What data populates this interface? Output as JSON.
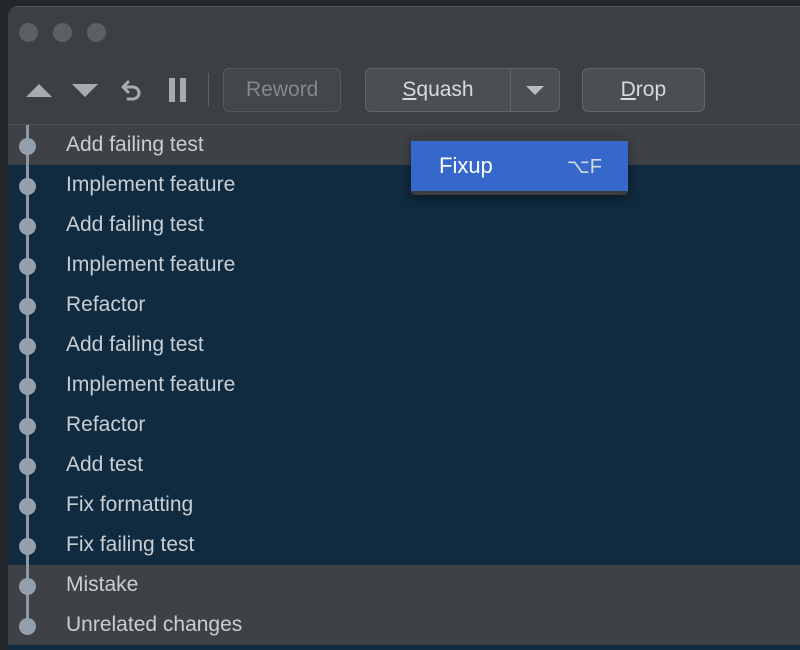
{
  "window": {
    "traffic_lights": [
      "close-button",
      "minimize-button",
      "zoom-button"
    ]
  },
  "toolbar": {
    "move_up_label": "",
    "move_down_label": "",
    "undo_label": "",
    "pause_label": "",
    "reword_label": "Reword",
    "reword_disabled": true,
    "squash_label": "Squash",
    "squash_mnemonic": "S",
    "squash_rest": "quash",
    "drop_label": "Drop",
    "drop_mnemonic": "D",
    "drop_rest": "rop",
    "dropdown_caret": "chevron-down-icon"
  },
  "menu": {
    "items": [
      {
        "label": "Fixup",
        "shortcut": "⌥F",
        "highlighted": true
      }
    ]
  },
  "commits": [
    {
      "subject": "Add failing test",
      "selected": true
    },
    {
      "subject": "Implement feature",
      "selected": false
    },
    {
      "subject": "Add failing test",
      "selected": false
    },
    {
      "subject": "Implement feature",
      "selected": false
    },
    {
      "subject": "Refactor",
      "selected": false
    },
    {
      "subject": "Add failing test",
      "selected": false
    },
    {
      "subject": "Implement feature",
      "selected": false
    },
    {
      "subject": "Refactor",
      "selected": false
    },
    {
      "subject": "Add test",
      "selected": false
    },
    {
      "subject": "Fix formatting",
      "selected": false
    },
    {
      "subject": "Fix failing test",
      "selected": false
    },
    {
      "subject": "Mistake",
      "selected": true
    },
    {
      "subject": "Unrelated changes",
      "selected": true
    }
  ],
  "colors": {
    "chrome": "#3c4043",
    "list_background": "#102a40",
    "selection": "#3e4246",
    "accent_blue": "#3568ca",
    "graph_node": "#93a0ab",
    "text": "#c9ced2"
  }
}
